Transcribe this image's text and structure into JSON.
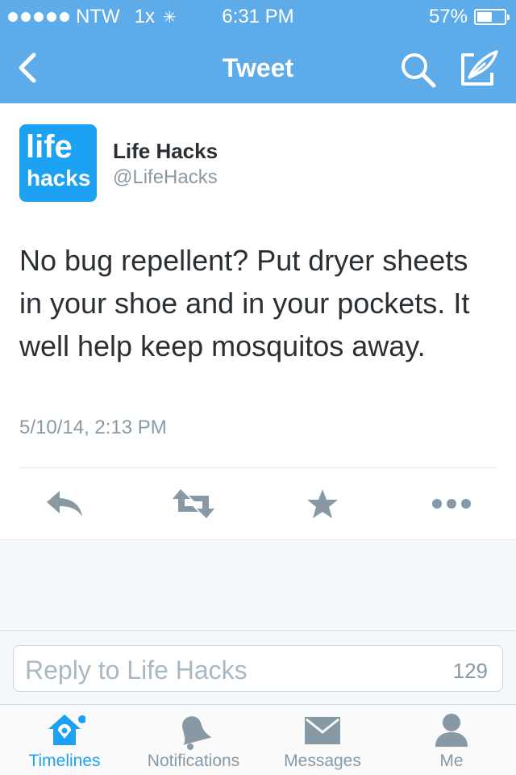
{
  "status_bar": {
    "carrier": "NTW",
    "signal_label": "1x",
    "time": "6:31 PM",
    "battery": "57%",
    "battery_level": 0.57
  },
  "navbar": {
    "title": "Tweet"
  },
  "tweet": {
    "avatar_line1": "life",
    "avatar_line2": "hacks",
    "name": "Life Hacks",
    "handle": "@LifeHacks",
    "text": "No bug repellent? Put dryer sheets in your shoe and in your pockets. It well help keep mosquitos away.",
    "timestamp": "5/10/14, 2:13 PM"
  },
  "reply": {
    "placeholder": "Reply to Life Hacks",
    "char_count": "129"
  },
  "tabs": [
    {
      "label": "Timelines",
      "icon": "home-icon",
      "active": true
    },
    {
      "label": "Notifications",
      "icon": "bell-icon",
      "active": false
    },
    {
      "label": "Messages",
      "icon": "envelope-icon",
      "active": false
    },
    {
      "label": "Me",
      "icon": "person-icon",
      "active": false
    }
  ],
  "colors": {
    "brand": "#5eabea",
    "active_tab": "#1da1f2",
    "icon_gray": "#8899a6"
  }
}
